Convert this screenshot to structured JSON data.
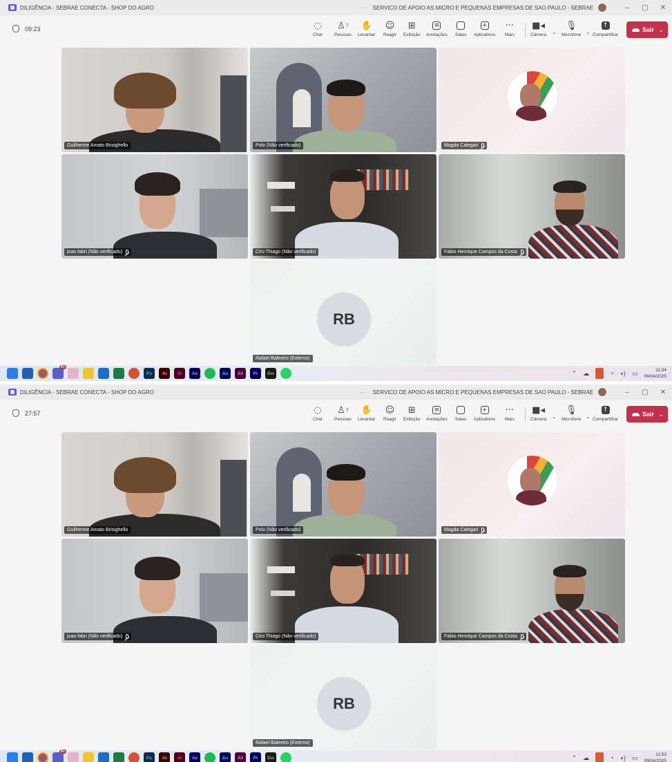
{
  "shots": [
    {
      "title_left": "DILIGÊNCIA - SEBRAE CONECTA - SHOP DO AGRO",
      "title_dots": "···",
      "title_org": "SERVICO DE APOIO AS MICRO E PEQUENAS EMPRESAS DE SAO PAULO - SEBRAE",
      "window_controls": [
        "–",
        "▢",
        "✕"
      ],
      "timer": "09:23",
      "tools": {
        "chat": "Chat",
        "people": "Pessoas",
        "people_count": "7",
        "raise": "Levantar",
        "react": "Reagir",
        "view": "Exibição",
        "notes": "Anotações",
        "rooms": "Salas",
        "apps": "Aplicativos",
        "more": "Mais",
        "camera": "Câmera",
        "mic": "Microfone",
        "share": "Compartilhar",
        "leave": "Sair"
      },
      "participants": {
        "p1": "Guilherme Amato Brisighello",
        "p2": "Polo (Não verificado)",
        "p3": "Magda Calegari",
        "p4": "joao fabri (Não verificado)",
        "p5": "Ciro Thiago (Não verificado)",
        "p6": "Fabio Henrique Campos da Costa",
        "p7": "Rafael Baleeiro (Externo)"
      },
      "rb_initials": "RB",
      "taskbar": {
        "ps": "Ps",
        "ai": "Ai",
        "id": "Id",
        "ae": "Ae",
        "au": "Au",
        "xd": "Xd",
        "pr": "Pr",
        "dw": "Dw",
        "teams_badge": "9+"
      },
      "tray": {
        "time": "11:34",
        "date": "09/04/2025"
      }
    },
    {
      "title_left": "DILIGÊNCIA - SEBRAE CONECTA - SHOP DO AGRO",
      "title_dots": "···",
      "title_org": "SERVICO DE APOIO AS MICRO E PEQUENAS EMPRESAS DE SAO PAULO - SEBRAE",
      "window_controls": [
        "–",
        "▢",
        "✕"
      ],
      "timer": "27:57",
      "tools": {
        "chat": "Chat",
        "people": "Pessoas",
        "people_count": "7",
        "raise": "Levantar",
        "react": "Reagir",
        "view": "Exibição",
        "notes": "Anotações",
        "rooms": "Salas",
        "apps": "Aplicativos",
        "more": "Mais",
        "camera": "Câmera",
        "mic": "Microfone",
        "share": "Compartilhar",
        "leave": "Sair"
      },
      "participants": {
        "p1": "Guilherme Amato Brisighello",
        "p2": "Polo (Não verificado)",
        "p3": "Magda Calegari",
        "p4": "joao fabri (Não verificado)",
        "p5": "Ciro Thiago (Não verificado)",
        "p6": "Fabio Henrique Campos da Costa",
        "p7": "Rafael Baleeiro (Externo)"
      },
      "rb_initials": "RB",
      "taskbar": {
        "ps": "Ps",
        "ai": "Ai",
        "id": "Id",
        "ae": "Ae",
        "au": "Au",
        "xd": "Xd",
        "pr": "Pr",
        "dw": "Dw",
        "teams_badge": "9+"
      },
      "tray": {
        "time": "11:53",
        "date": "09/04/2025"
      }
    }
  ]
}
